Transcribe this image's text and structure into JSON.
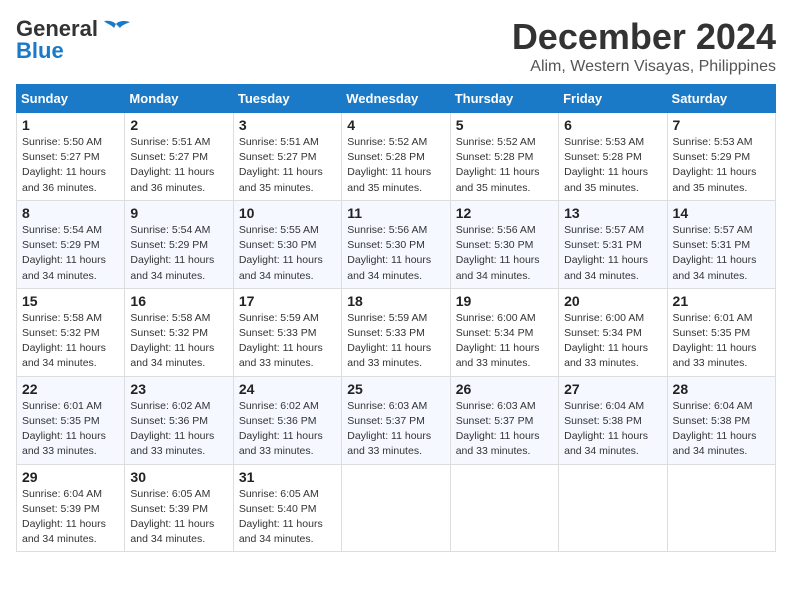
{
  "logo": {
    "line1": "General",
    "line2": "Blue"
  },
  "title": "December 2024",
  "subtitle": "Alim, Western Visayas, Philippines",
  "days_of_week": [
    "Sunday",
    "Monday",
    "Tuesday",
    "Wednesday",
    "Thursday",
    "Friday",
    "Saturday"
  ],
  "weeks": [
    [
      {
        "day": "1",
        "sunrise": "Sunrise: 5:50 AM",
        "sunset": "Sunset: 5:27 PM",
        "daylight": "Daylight: 11 hours and 36 minutes."
      },
      {
        "day": "2",
        "sunrise": "Sunrise: 5:51 AM",
        "sunset": "Sunset: 5:27 PM",
        "daylight": "Daylight: 11 hours and 36 minutes."
      },
      {
        "day": "3",
        "sunrise": "Sunrise: 5:51 AM",
        "sunset": "Sunset: 5:27 PM",
        "daylight": "Daylight: 11 hours and 35 minutes."
      },
      {
        "day": "4",
        "sunrise": "Sunrise: 5:52 AM",
        "sunset": "Sunset: 5:28 PM",
        "daylight": "Daylight: 11 hours and 35 minutes."
      },
      {
        "day": "5",
        "sunrise": "Sunrise: 5:52 AM",
        "sunset": "Sunset: 5:28 PM",
        "daylight": "Daylight: 11 hours and 35 minutes."
      },
      {
        "day": "6",
        "sunrise": "Sunrise: 5:53 AM",
        "sunset": "Sunset: 5:28 PM",
        "daylight": "Daylight: 11 hours and 35 minutes."
      },
      {
        "day": "7",
        "sunrise": "Sunrise: 5:53 AM",
        "sunset": "Sunset: 5:29 PM",
        "daylight": "Daylight: 11 hours and 35 minutes."
      }
    ],
    [
      {
        "day": "8",
        "sunrise": "Sunrise: 5:54 AM",
        "sunset": "Sunset: 5:29 PM",
        "daylight": "Daylight: 11 hours and 34 minutes."
      },
      {
        "day": "9",
        "sunrise": "Sunrise: 5:54 AM",
        "sunset": "Sunset: 5:29 PM",
        "daylight": "Daylight: 11 hours and 34 minutes."
      },
      {
        "day": "10",
        "sunrise": "Sunrise: 5:55 AM",
        "sunset": "Sunset: 5:30 PM",
        "daylight": "Daylight: 11 hours and 34 minutes."
      },
      {
        "day": "11",
        "sunrise": "Sunrise: 5:56 AM",
        "sunset": "Sunset: 5:30 PM",
        "daylight": "Daylight: 11 hours and 34 minutes."
      },
      {
        "day": "12",
        "sunrise": "Sunrise: 5:56 AM",
        "sunset": "Sunset: 5:30 PM",
        "daylight": "Daylight: 11 hours and 34 minutes."
      },
      {
        "day": "13",
        "sunrise": "Sunrise: 5:57 AM",
        "sunset": "Sunset: 5:31 PM",
        "daylight": "Daylight: 11 hours and 34 minutes."
      },
      {
        "day": "14",
        "sunrise": "Sunrise: 5:57 AM",
        "sunset": "Sunset: 5:31 PM",
        "daylight": "Daylight: 11 hours and 34 minutes."
      }
    ],
    [
      {
        "day": "15",
        "sunrise": "Sunrise: 5:58 AM",
        "sunset": "Sunset: 5:32 PM",
        "daylight": "Daylight: 11 hours and 34 minutes."
      },
      {
        "day": "16",
        "sunrise": "Sunrise: 5:58 AM",
        "sunset": "Sunset: 5:32 PM",
        "daylight": "Daylight: 11 hours and 34 minutes."
      },
      {
        "day": "17",
        "sunrise": "Sunrise: 5:59 AM",
        "sunset": "Sunset: 5:33 PM",
        "daylight": "Daylight: 11 hours and 33 minutes."
      },
      {
        "day": "18",
        "sunrise": "Sunrise: 5:59 AM",
        "sunset": "Sunset: 5:33 PM",
        "daylight": "Daylight: 11 hours and 33 minutes."
      },
      {
        "day": "19",
        "sunrise": "Sunrise: 6:00 AM",
        "sunset": "Sunset: 5:34 PM",
        "daylight": "Daylight: 11 hours and 33 minutes."
      },
      {
        "day": "20",
        "sunrise": "Sunrise: 6:00 AM",
        "sunset": "Sunset: 5:34 PM",
        "daylight": "Daylight: 11 hours and 33 minutes."
      },
      {
        "day": "21",
        "sunrise": "Sunrise: 6:01 AM",
        "sunset": "Sunset: 5:35 PM",
        "daylight": "Daylight: 11 hours and 33 minutes."
      }
    ],
    [
      {
        "day": "22",
        "sunrise": "Sunrise: 6:01 AM",
        "sunset": "Sunset: 5:35 PM",
        "daylight": "Daylight: 11 hours and 33 minutes."
      },
      {
        "day": "23",
        "sunrise": "Sunrise: 6:02 AM",
        "sunset": "Sunset: 5:36 PM",
        "daylight": "Daylight: 11 hours and 33 minutes."
      },
      {
        "day": "24",
        "sunrise": "Sunrise: 6:02 AM",
        "sunset": "Sunset: 5:36 PM",
        "daylight": "Daylight: 11 hours and 33 minutes."
      },
      {
        "day": "25",
        "sunrise": "Sunrise: 6:03 AM",
        "sunset": "Sunset: 5:37 PM",
        "daylight": "Daylight: 11 hours and 33 minutes."
      },
      {
        "day": "26",
        "sunrise": "Sunrise: 6:03 AM",
        "sunset": "Sunset: 5:37 PM",
        "daylight": "Daylight: 11 hours and 33 minutes."
      },
      {
        "day": "27",
        "sunrise": "Sunrise: 6:04 AM",
        "sunset": "Sunset: 5:38 PM",
        "daylight": "Daylight: 11 hours and 34 minutes."
      },
      {
        "day": "28",
        "sunrise": "Sunrise: 6:04 AM",
        "sunset": "Sunset: 5:38 PM",
        "daylight": "Daylight: 11 hours and 34 minutes."
      }
    ],
    [
      {
        "day": "29",
        "sunrise": "Sunrise: 6:04 AM",
        "sunset": "Sunset: 5:39 PM",
        "daylight": "Daylight: 11 hours and 34 minutes."
      },
      {
        "day": "30",
        "sunrise": "Sunrise: 6:05 AM",
        "sunset": "Sunset: 5:39 PM",
        "daylight": "Daylight: 11 hours and 34 minutes."
      },
      {
        "day": "31",
        "sunrise": "Sunrise: 6:05 AM",
        "sunset": "Sunset: 5:40 PM",
        "daylight": "Daylight: 11 hours and 34 minutes."
      },
      null,
      null,
      null,
      null
    ]
  ]
}
